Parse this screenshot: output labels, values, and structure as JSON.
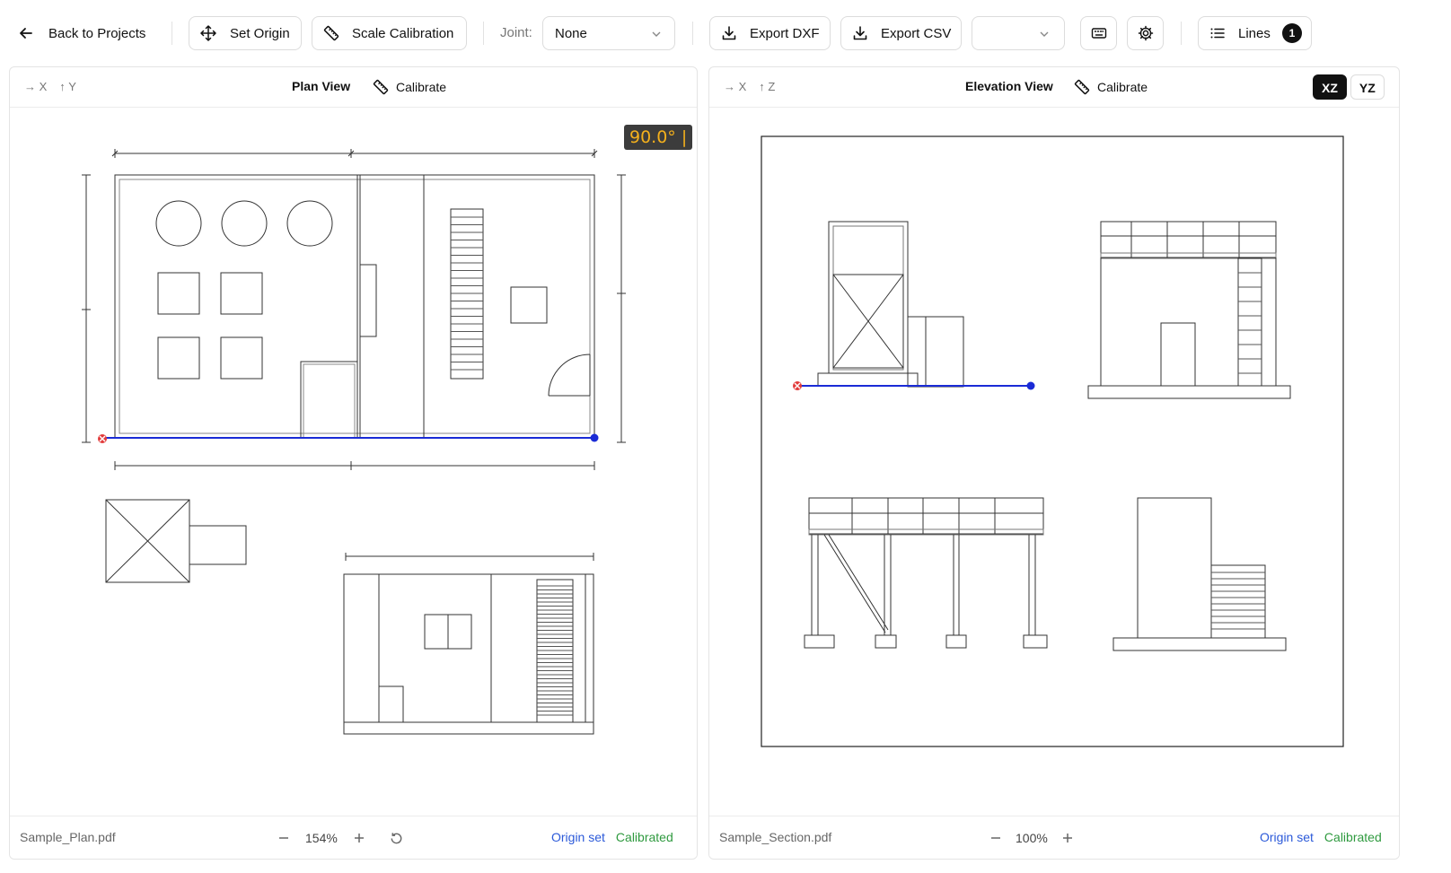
{
  "toolbar": {
    "back_label": "Back to Projects",
    "set_origin_label": "Set Origin",
    "scale_calibration_label": "Scale Calibration",
    "joint_label": "Joint:",
    "joint_value": "None",
    "export_dxf_label": "Export DXF",
    "export_csv_label": "Export CSV",
    "lines_label": "Lines",
    "lines_count": "1"
  },
  "plan": {
    "axis_x": "X",
    "axis_y": "Y",
    "title": "Plan View",
    "calibrate_label": "Calibrate",
    "angle_readout": "90.0° |",
    "file_name": "Sample_Plan.pdf",
    "zoom": "154%",
    "status_origin": "Origin set",
    "status_calibrated": "Calibrated"
  },
  "elevation": {
    "axis_x": "X",
    "axis_z": "Z",
    "title": "Elevation View",
    "calibrate_label": "Calibrate",
    "view_xz": "XZ",
    "view_yz": "YZ",
    "file_name": "Sample_Section.pdf",
    "zoom": "100%",
    "status_origin": "Origin set",
    "status_calibrated": "Calibrated"
  },
  "colors": {
    "measure_line": "#1a2bd6",
    "origin_marker": "#e23a3a",
    "angle_text": "#f4b01c",
    "origin_status": "#2b59d9",
    "calibrated_status": "#2f9a3f"
  }
}
